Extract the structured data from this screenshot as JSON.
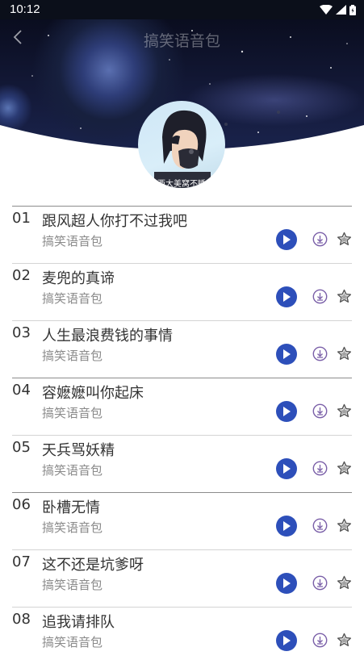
{
  "status_bar": {
    "time": "10:12",
    "icons": [
      "wifi-icon",
      "signal-icon",
      "battery-icon"
    ]
  },
  "header": {
    "title": "搞笑语音包",
    "back_icon": "chevron-left-icon"
  },
  "avatar": {
    "caption": "西大美窝不睡"
  },
  "colors": {
    "play_button": "#2d4fba",
    "download_icon": "#7a5fa8",
    "star_icon": "#555555"
  },
  "tracks": [
    {
      "num": "01",
      "title": "跟风超人你打不过我吧",
      "subtitle": "搞笑语音包"
    },
    {
      "num": "02",
      "title": "麦兜的真谛",
      "subtitle": "搞笑语音包"
    },
    {
      "num": "03",
      "title": "人生最浪费钱的事情",
      "subtitle": "搞笑语音包"
    },
    {
      "num": "04",
      "title": "容嬷嬷叫你起床",
      "subtitle": "搞笑语音包"
    },
    {
      "num": "05",
      "title": "天兵骂妖精",
      "subtitle": "搞笑语音包"
    },
    {
      "num": "06",
      "title": "卧槽无情",
      "subtitle": "搞笑语音包"
    },
    {
      "num": "07",
      "title": "这不还是坑爹呀",
      "subtitle": "搞笑语音包"
    },
    {
      "num": "08",
      "title": "追我请排队",
      "subtitle": "搞笑语音包"
    }
  ]
}
